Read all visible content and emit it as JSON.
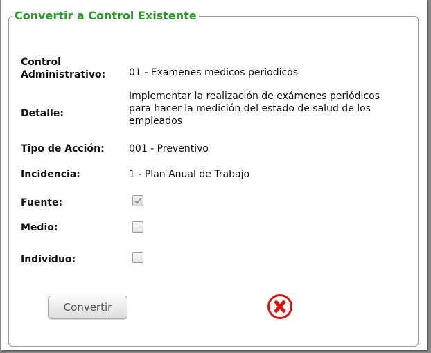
{
  "form": {
    "legend": "Convertir a Control Existente",
    "fields": {
      "control_label_line1": "Control",
      "control_label_line2": "Administrativo:",
      "control_value": "01 - Examenes medicos periodicos",
      "detalle_label": "Detalle:",
      "detalle_line1": "Implementar la realización de exámenes periódicos",
      "detalle_line2": "para hacer la medición del estado de salud de los",
      "detalle_line3": "empleados",
      "tipo_label": "Tipo de Acción:",
      "tipo_value": "001 - Preventivo",
      "incidencia_label": "Incidencia:",
      "incidencia_value": "1 - Plan Anual de Trabajo",
      "fuente_label": "Fuente:",
      "medio_label": "Medio:",
      "individuo_label": "Individuo:"
    },
    "checkboxes": {
      "fuente": true,
      "medio": false,
      "individuo": false
    },
    "convert_button": "Convertir",
    "colors": {
      "legend": "#2a9a2a",
      "close_icon": "#e01010"
    },
    "close_icon": "close-x-circle-icon"
  }
}
